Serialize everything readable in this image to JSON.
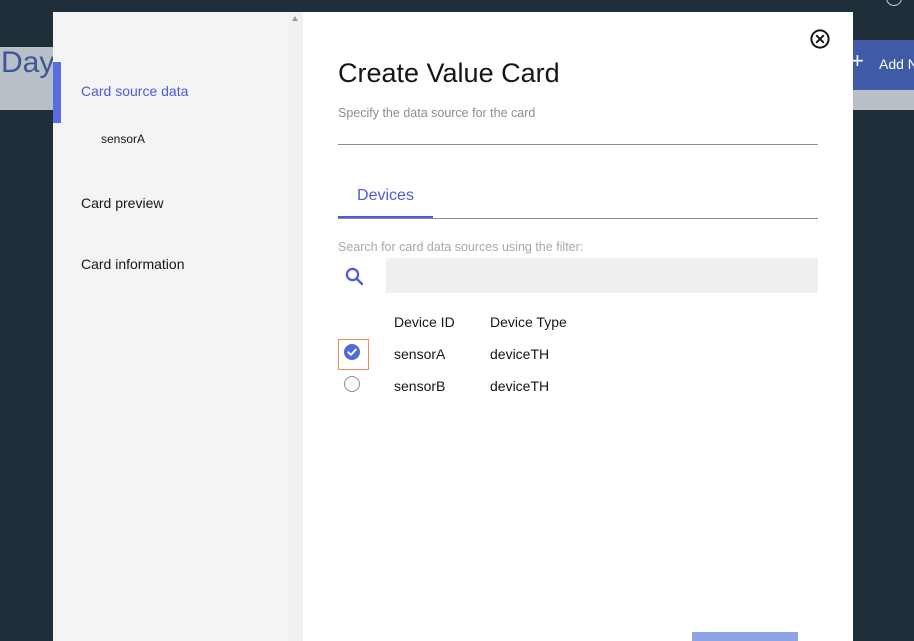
{
  "background": {
    "page_title_fragment": "Day",
    "add_button_label": "Add N"
  },
  "modal": {
    "title": "Create Value Card",
    "subtitle": "Specify the data source for the card",
    "nav": [
      {
        "label": "Card source data",
        "active": true
      },
      {
        "label": "Card preview",
        "active": false
      },
      {
        "label": "Card information",
        "active": false
      }
    ],
    "nav_sub": {
      "label": "sensorA"
    },
    "tabs": [
      {
        "label": "Devices",
        "selected": true
      }
    ],
    "search": {
      "label": "Search for card data sources using the filter:",
      "value": "",
      "placeholder": ""
    },
    "table": {
      "columns": [
        "Device ID",
        "Device Type"
      ],
      "rows": [
        {
          "device_id": "sensorA",
          "device_type": "deviceTH",
          "selected": true
        },
        {
          "device_id": "sensorB",
          "device_type": "deviceTH",
          "selected": false
        }
      ]
    },
    "icons": {
      "close": "close-circle-icon",
      "search": "search-icon"
    }
  },
  "colors": {
    "accent": "#4d5bd6",
    "backdrop": "#1f2f3a",
    "focus_outline": "#f28b5b",
    "primary_button": "#8ea3e8"
  }
}
